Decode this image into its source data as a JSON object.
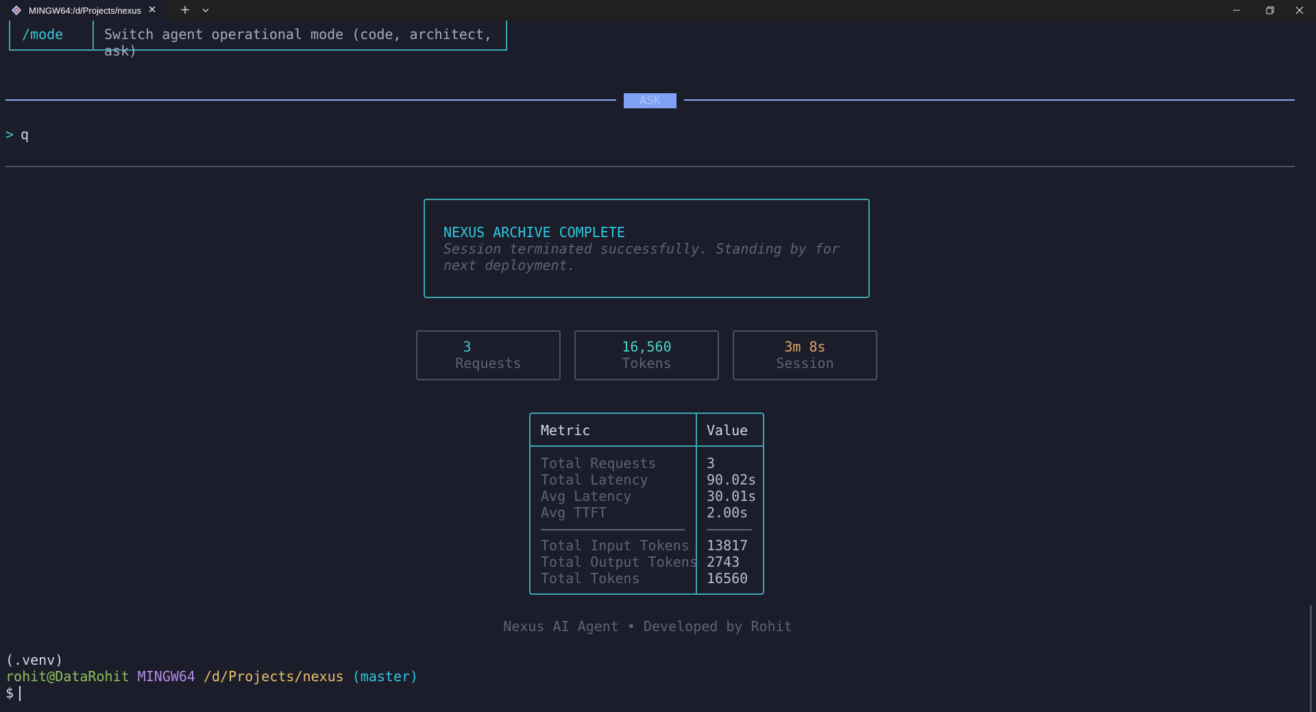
{
  "window": {
    "tab_title": "MINGW64:/d/Projects/nexus",
    "icons": [
      "git-bash-icon",
      "close-icon",
      "plus-icon",
      "chevron-down-icon",
      "minimize-icon",
      "maximize-icon",
      "window-close-icon"
    ]
  },
  "command_table": {
    "command": "/mode",
    "description": "Switch agent operational mode (code, architect, ask)"
  },
  "mode": {
    "label": "ASK"
  },
  "prompt": {
    "arrow": ">",
    "text": "q"
  },
  "archive": {
    "title": "NEXUS ARCHIVE COMPLETE",
    "subtitle": "Session terminated successfully. Standing by for next deployment."
  },
  "stats": [
    {
      "value": "3",
      "label": "Requests"
    },
    {
      "value": "16,560",
      "label": "Tokens"
    },
    {
      "value": "3m 8s",
      "label": "Session"
    }
  ],
  "metrics": {
    "header_metric": "Metric",
    "header_value": "Value",
    "rows": [
      {
        "metric": "Total Requests",
        "value": "3"
      },
      {
        "metric": "Total Latency",
        "value": "90.02s"
      },
      {
        "metric": "Avg Latency",
        "value": "30.01s"
      },
      {
        "metric": "Avg TTFT",
        "value": "2.00s"
      },
      {
        "metric": "Total Input Tokens",
        "value": "13817"
      },
      {
        "metric": "Total Output Tokens",
        "value": "2743"
      },
      {
        "metric": "Total Tokens",
        "value": "16560"
      }
    ]
  },
  "footer": "Nexus AI Agent • Developed by Rohit",
  "shell": {
    "venv": "(.venv)",
    "user": "rohit@DataRohit",
    "host": "MINGW64",
    "path": "/d/Projects/nexus",
    "branch": "(master)",
    "prompt_symbol": "$"
  },
  "colors": {
    "background": "#1c1d2a",
    "accent_teal": "#3aa7b3",
    "mode_blue": "#7fa2f7"
  }
}
